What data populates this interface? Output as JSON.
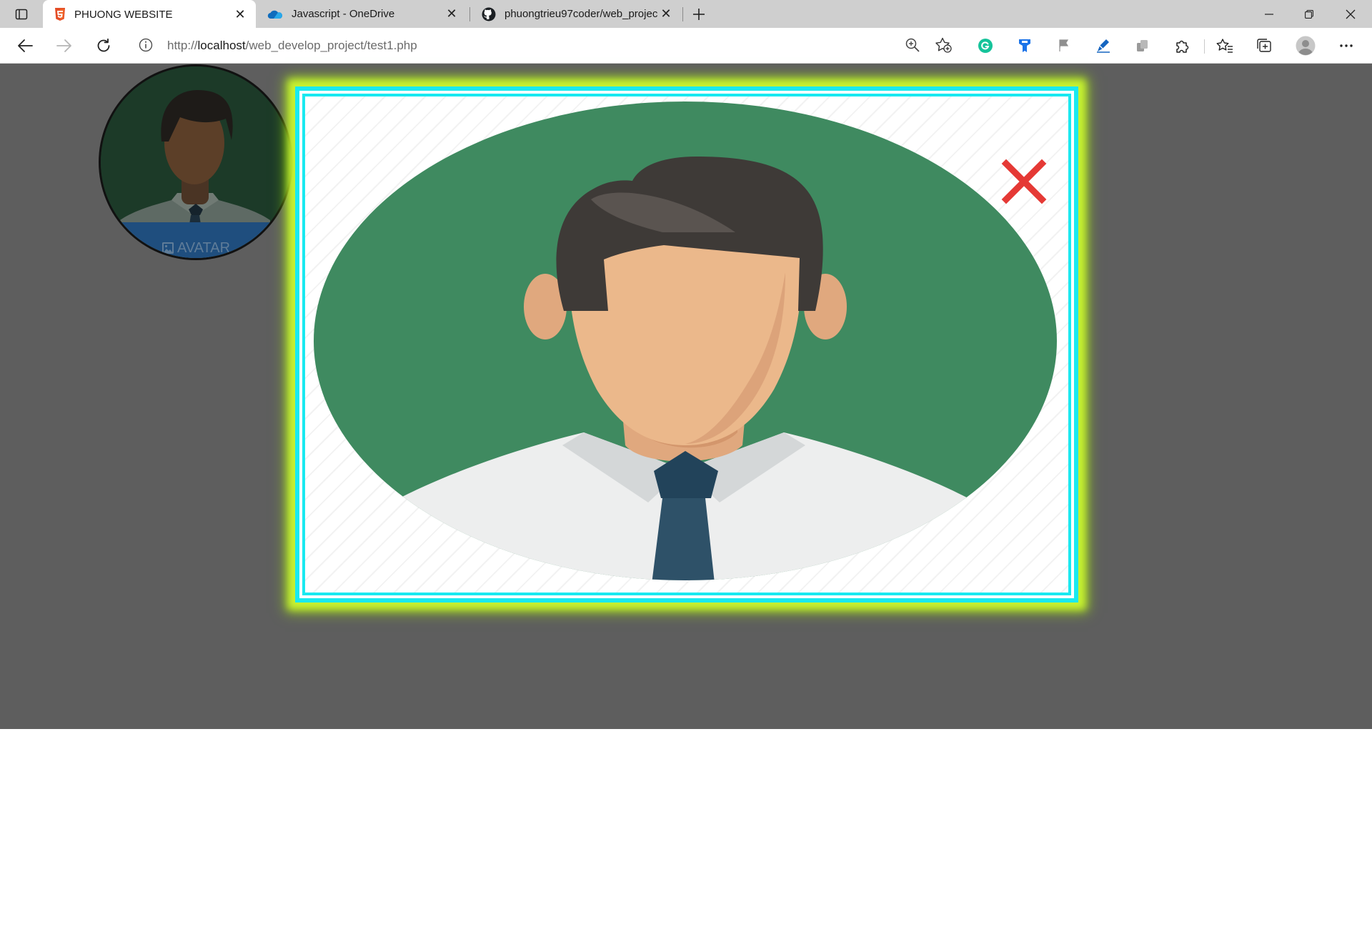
{
  "browser": {
    "tabs": [
      {
        "title": "PHUONG WEBSITE",
        "icon": "html5-icon",
        "active": true
      },
      {
        "title": "Javascript - OneDrive",
        "icon": "onedrive-icon",
        "active": false
      },
      {
        "title": "phuongtrieu97coder/web_projec",
        "icon": "github-icon",
        "active": false
      }
    ],
    "address": {
      "prefix": "http://",
      "host": "localhost",
      "path": "/web_develop_project/test1.php"
    }
  },
  "avatar": {
    "label": "AVATAR",
    "icon": "image-icon"
  },
  "modal": {
    "close_icon": "close-icon",
    "image": "male-avatar-illustration"
  },
  "colors": {
    "page_bg": "#5e5e5e",
    "modal_border": "#19e9f0",
    "modal_glow": "#c8f231",
    "avatar_bg": "#3f8a60",
    "avatar_bar": "#1f4e7e",
    "close": "#e53935"
  }
}
